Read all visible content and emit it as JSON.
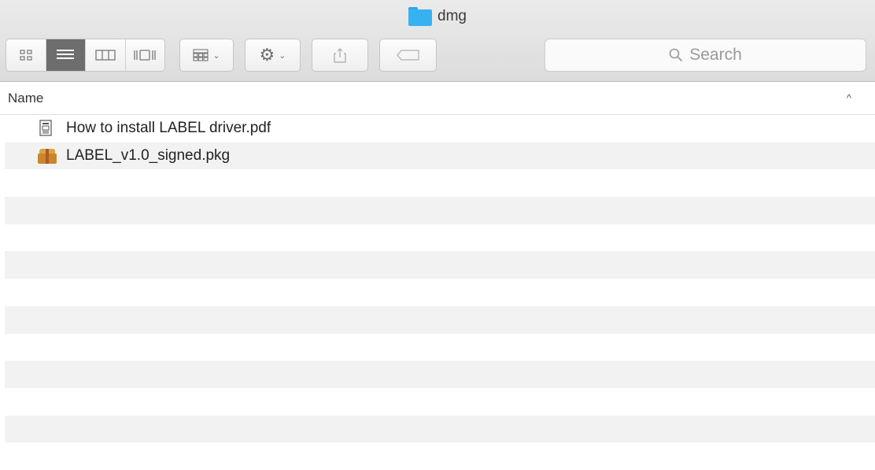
{
  "window": {
    "title": "dmg"
  },
  "toolbar": {
    "view_modes": [
      "icon-view",
      "list-view",
      "column-view",
      "cover-flow-view"
    ],
    "active_view": "list-view"
  },
  "search": {
    "placeholder": "Search"
  },
  "list": {
    "column_header": "Name",
    "items": [
      {
        "name": "How to install LABEL driver.pdf",
        "icon": "pdf-document-icon"
      },
      {
        "name": "LABEL_v1.0_signed.pkg",
        "icon": "package-icon"
      }
    ]
  }
}
